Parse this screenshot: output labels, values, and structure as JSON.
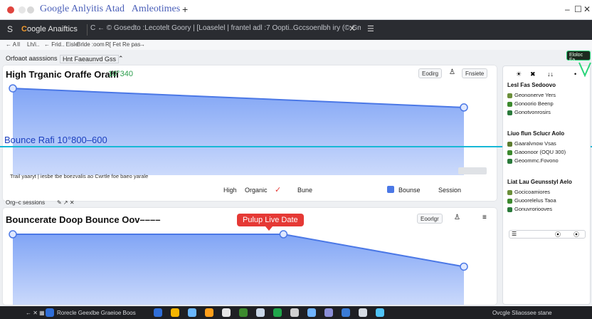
{
  "window": {
    "tab_title": "Google Anlyitis Atad   Amleotimes",
    "new_tab": "+",
    "controls": [
      "–",
      "☐",
      "✕"
    ]
  },
  "toolbar": {
    "menu": "S",
    "brand_prefix": "C",
    "brand": "oogle",
    "brand_suffix": "Anaiftics",
    "url": "C ← © Gosedto :Lecotelt Goory | [Loaselel | frantel adl :7 Oopti..Gccsoenlbh iry (© Gmd | [ckvnh Ss| [a (Gth | (/aclr",
    "url_close": "✕",
    "ext": "☰"
  },
  "subbar": {
    "items": [
      "← A",
      "Il",
      "Lh/i..",
      "← Frid.. Eisle",
      "Brlde :oom",
      "R[ Fet Re pas",
      "→"
    ]
  },
  "crumbs": {
    "left": "Orfoaot aasssions",
    "mid": "Hnt Faeaunvd Gss",
    "toggle": "⌃"
  },
  "panel1": {
    "title": "High Trganic Oraffe Oraffi",
    "title_suffix": "10°340",
    "chip1": "Eodirg",
    "chip2_icon": "person-icon",
    "chip3": "Fnsiete",
    "footnote": "Trail yaaryt | iesbe tbe boezvalis ao Cwrtle foe baeo yarale",
    "legend_high": "High",
    "legend_organic": "Organic",
    "legend_bune": "Bune",
    "legend_bounce": "Bounse",
    "legend_session": "Session"
  },
  "overlay": {
    "label": "Bounce Rafi 10°800–600",
    "label2": "OQU 300)"
  },
  "section2": {
    "crumb": "Org–c sessions",
    "crumb_icons": "✎ ↗ ✕"
  },
  "panel2": {
    "title": "Bouncerate Doop Bounce Oov––––",
    "chip1": "Eoorlgr",
    "tooltip": "Pulup Live Date"
  },
  "sidebar": {
    "toolbar_icons": [
      "☀",
      "✖",
      "↓↓",
      "•"
    ],
    "heads": [
      "Lesl  Fas Sedoovo",
      "Liuo flun Sclucr Aolo",
      "Liat Lau Geunsstyl Aelo"
    ],
    "rows": [
      [
        "Geononerve Yers",
        "Gonoorio Beenp",
        "Gonotvonrosirs"
      ],
      [
        "Gaaralvnow Vsas",
        "Gaoonoor (OQU 300)",
        "Geoommc.Fovono"
      ],
      [
        "Gocicoamiores",
        "Guoorelelus Taoa",
        "Gonuvroriooves"
      ]
    ],
    "search_icons": [
      "☰",
      "⦿",
      "⦿"
    ],
    "green_button": "Eloloc Fa"
  },
  "taskbar": {
    "left": "← ✕ ▦",
    "search_text": "Rorecle Geexlbe Graeioe Boos",
    "right": "Ovcgle Sliaossee stane",
    "colors": [
      "#2f6ed8",
      "#f4b400",
      "#6ab7ff",
      "#ff9f1a",
      "#e5e5e5",
      "#3c8a2e",
      "#c9d7e8",
      "#1fa64a",
      "#d0d0d0",
      "#6fb3ff",
      "#8b8fd8",
      "#3a7bd5",
      "#d5dbe3",
      "#4fc3f7"
    ]
  },
  "chart_data": [
    {
      "type": "area",
      "title": "High Trganic Oraffe Oraffi",
      "points": [
        [
          0,
          1.0
        ],
        [
          1,
          0.78
        ]
      ],
      "ylim": [
        0,
        1.05
      ]
    },
    {
      "type": "line",
      "title": "Bouncerate Doop Bounce Oov––––",
      "points": [
        [
          0,
          1.0
        ],
        [
          0.6,
          1.0
        ],
        [
          1,
          0.55
        ]
      ],
      "ylim": [
        0,
        1.05
      ]
    }
  ],
  "colors": {
    "area_fill": "#7aa0f5",
    "area_stroke": "#4b78e6",
    "overlay_line": "#17b8d6",
    "tooltip": "#e53935"
  }
}
